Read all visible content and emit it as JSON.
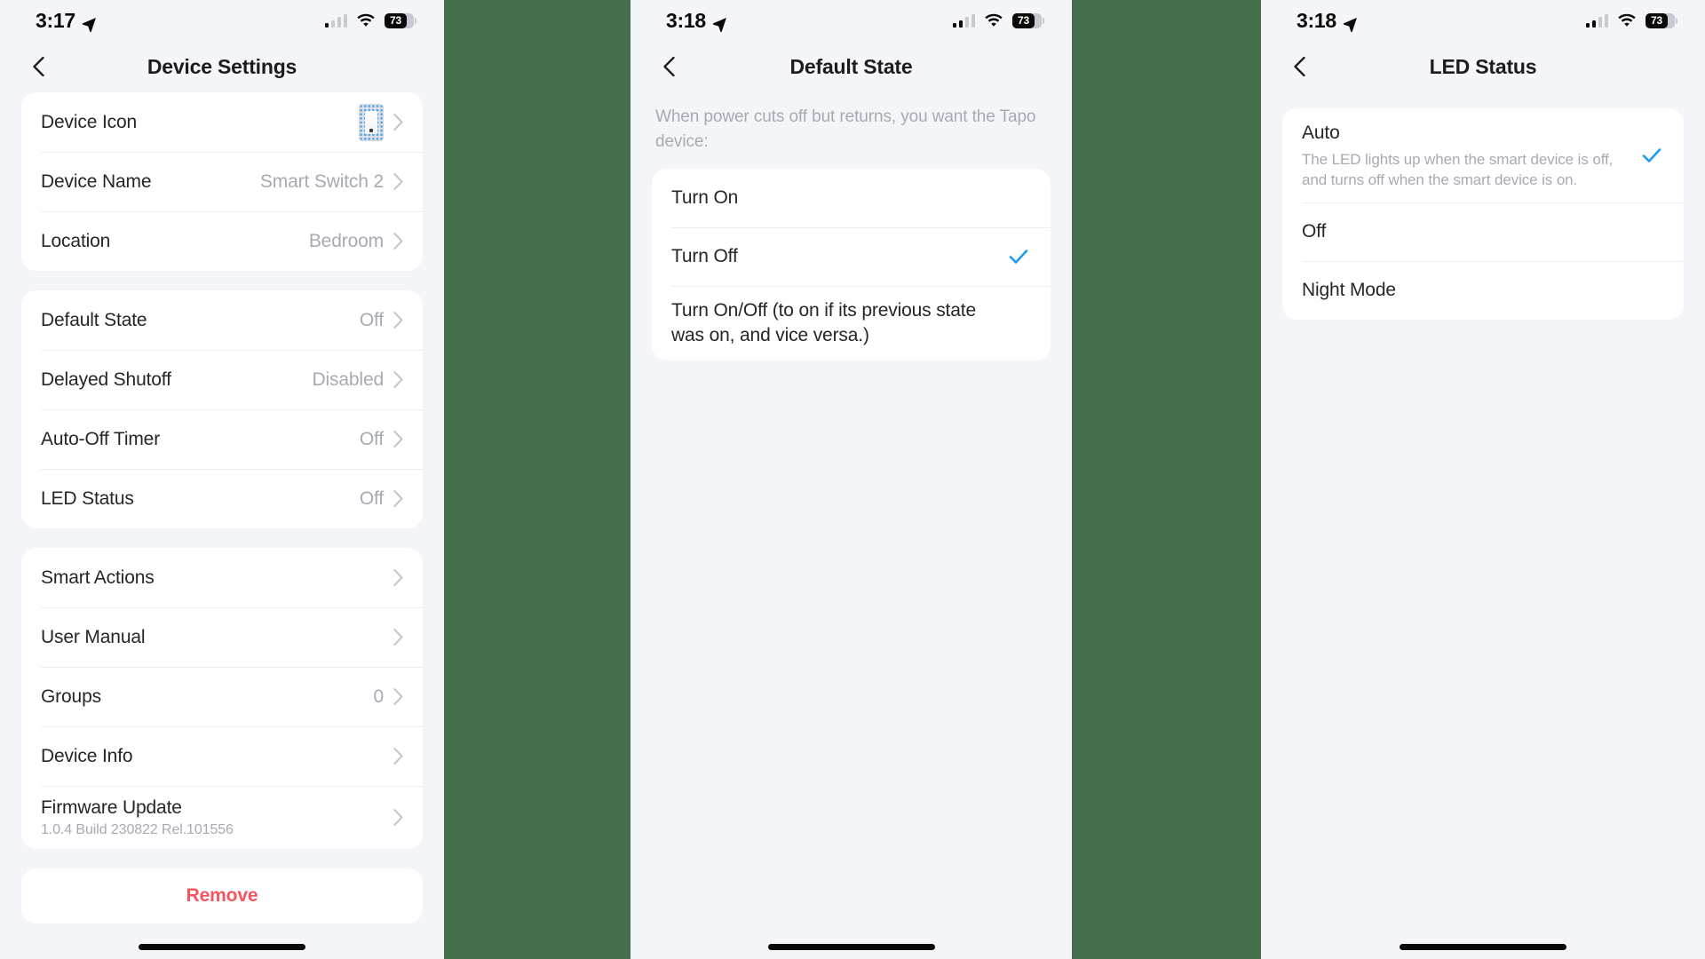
{
  "theme": {
    "background_green": "#46704D",
    "screen_background": "#F4F5F8",
    "card_background": "#FFFFFF",
    "accent_blue": "#1D9BF0",
    "destructive_red": "#F4555E",
    "secondary_text": "#A7AAB3",
    "primary_text": "#26262A"
  },
  "screens": [
    {
      "id": "device-settings",
      "status_bar": {
        "time": "3:17",
        "location_icon": "location-arrow-icon",
        "signal_icon": "cellular-signal-icon",
        "wifi_icon": "wifi-icon",
        "battery_percent": "73",
        "battery_icon": "battery-icon"
      },
      "nav": {
        "back_icon": "chevron-left-icon",
        "title": "Device Settings"
      },
      "groups": [
        {
          "rows": [
            {
              "label": "Device Icon",
              "value": "",
              "thumb": "device-icon-thumbnail",
              "chevron": true
            },
            {
              "label": "Device Name",
              "value": "Smart Switch 2",
              "chevron": true
            },
            {
              "label": "Location",
              "value": "Bedroom",
              "chevron": true
            }
          ]
        },
        {
          "rows": [
            {
              "label": "Default State",
              "value": "Off",
              "chevron": true
            },
            {
              "label": "Delayed Shutoff",
              "value": "Disabled",
              "chevron": true
            },
            {
              "label": "Auto-Off Timer",
              "value": "Off",
              "chevron": true
            },
            {
              "label": "LED Status",
              "value": "Off",
              "chevron": true
            }
          ]
        },
        {
          "rows": [
            {
              "label": "Smart Actions",
              "value": "",
              "chevron": true
            },
            {
              "label": "User Manual",
              "value": "",
              "chevron": true
            },
            {
              "label": "Groups",
              "value": "0",
              "chevron": true
            },
            {
              "label": "Device Info",
              "value": "",
              "chevron": true
            },
            {
              "label": "Firmware Update",
              "sub": "1.0.4 Build 230822 Rel.101556",
              "value": "",
              "chevron": true
            }
          ]
        }
      ],
      "remove_button": "Remove"
    },
    {
      "id": "default-state",
      "status_bar": {
        "time": "3:18",
        "location_icon": "location-arrow-icon",
        "signal_icon": "cellular-signal-icon",
        "wifi_icon": "wifi-icon",
        "battery_percent": "73",
        "battery_icon": "battery-icon"
      },
      "nav": {
        "back_icon": "chevron-left-icon",
        "title": "Default State"
      },
      "description": "When power cuts off but returns, you want the Tapo device:",
      "options": [
        {
          "title": "Turn On",
          "desc": "",
          "selected": false
        },
        {
          "title": "Turn Off",
          "desc": "",
          "selected": true
        },
        {
          "title": "Turn On/Off (to on if its previous state was on, and vice versa.)",
          "desc": "",
          "selected": false
        }
      ]
    },
    {
      "id": "led-status",
      "status_bar": {
        "time": "3:18",
        "location_icon": "location-arrow-icon",
        "signal_icon": "cellular-signal-icon",
        "wifi_icon": "wifi-icon",
        "battery_percent": "73",
        "battery_icon": "battery-icon"
      },
      "nav": {
        "back_icon": "chevron-left-icon",
        "title": "LED Status"
      },
      "description": "",
      "options": [
        {
          "title": "Auto",
          "desc": "The LED lights up when the smart device is off, and turns off when the smart device is on.",
          "selected": true
        },
        {
          "title": "Off",
          "desc": "",
          "selected": false
        },
        {
          "title": "Night Mode",
          "desc": "",
          "selected": false
        }
      ]
    }
  ]
}
